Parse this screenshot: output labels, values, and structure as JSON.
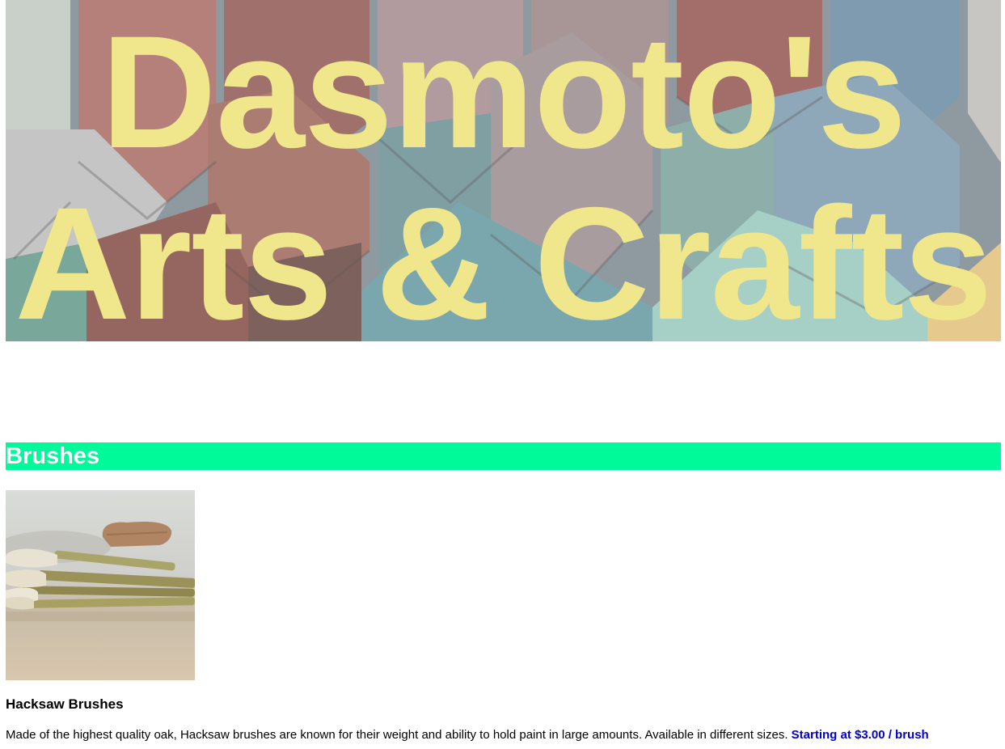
{
  "banner": {
    "title_line1": "Dasmoto's",
    "title_line2": "Arts & Crafts",
    "title_color": "#f0e68c"
  },
  "sections": [
    {
      "title": "Brushes",
      "header_color": "#00fa9a",
      "products": [
        {
          "name": "Hacksaw Brushes",
          "description": "Made of the highest quality oak, Hacksaw brushes are known for their weight and ability to hold paint in large amounts. Available in different sizes.",
          "price": "Starting at $3.00 / brush",
          "price_color": "#0000cd"
        }
      ]
    }
  ]
}
